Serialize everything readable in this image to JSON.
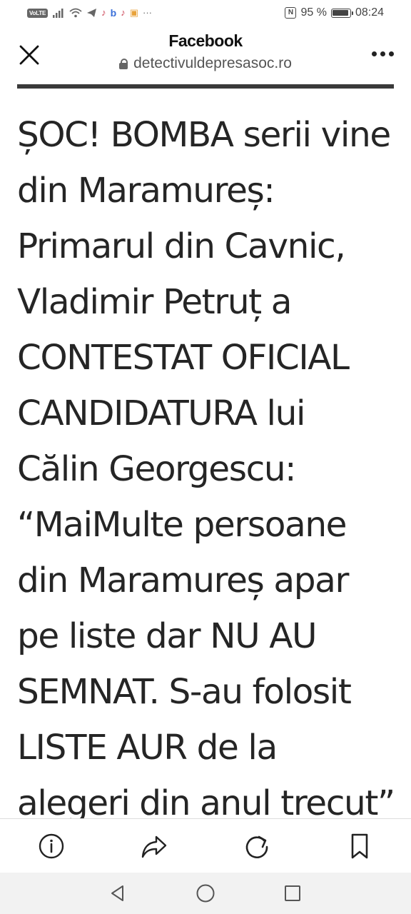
{
  "status_bar": {
    "volte": "VoLTE",
    "nfc": "N",
    "battery_text": "95 %",
    "battery_level": 0.95,
    "time": "08:24",
    "more_indicator": "···",
    "icons": [
      "signal-icon",
      "wifi-icon",
      "telegram-icon",
      "tiktok-icon",
      "b-app-icon",
      "tiktok-icon",
      "gift-icon",
      "nfc-icon",
      "battery-icon"
    ]
  },
  "header": {
    "app_title": "Facebook",
    "url": "detectivuldepresasoc.ro",
    "icons": [
      "close-icon",
      "lock-icon",
      "more-icon"
    ]
  },
  "article": {
    "title_lines": [
      "ȘOC! BOMBA serii vine",
      "din Maramureș:",
      "Primarul din Cavnic,",
      "Vladimir Petruț a",
      "CONTESTAT OFICIAL",
      "CANDIDATURA lui",
      "Călin Georgescu:",
      "“MaiMulte persoane",
      "din Maramureș apar",
      "pe liste dar NU AU",
      "SEMNAT. S-au folosit",
      "LISTE AUR de la",
      "alegeri din anul trecut”"
    ]
  },
  "bottom_bar": {
    "icons": [
      "info-icon",
      "share-icon",
      "reload-icon",
      "bookmark-icon"
    ]
  },
  "nav_bar": {
    "icons": [
      "back-icon",
      "home-icon",
      "recents-icon"
    ]
  },
  "colors": {
    "text": "#252525",
    "rule": "#3a3a3a",
    "nav_bg": "#f2f2f2"
  }
}
